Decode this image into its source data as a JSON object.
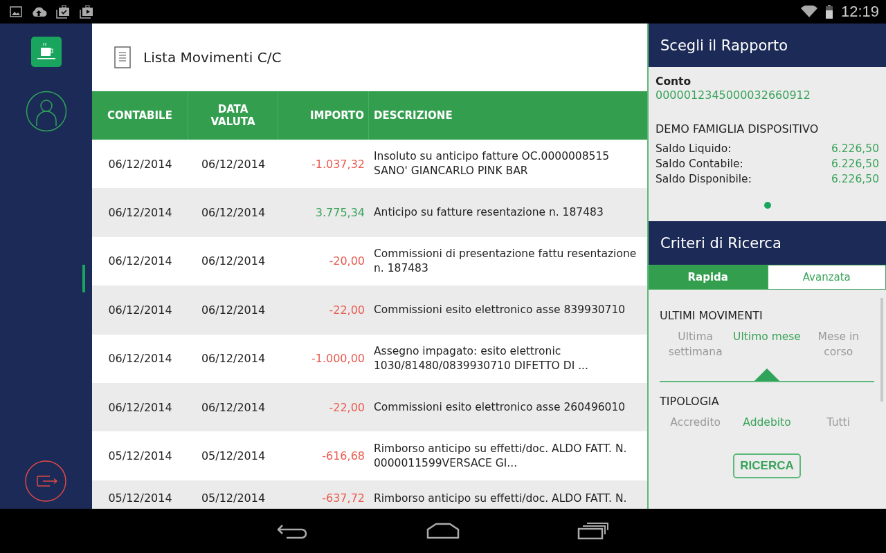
{
  "status_bar": {
    "time": "12:19"
  },
  "page": {
    "title": "Lista Movimenti C/C"
  },
  "table": {
    "columns": [
      "CONTABILE",
      "DATA VALUTA",
      "IMPORTO",
      "DESCRIZIONE"
    ],
    "rows": [
      {
        "contabile": "06/12/2014",
        "valuta": "06/12/2014",
        "importo": "-1.037,32",
        "kind": "debit",
        "descrizione": "Insoluto su anticipo fatture OC.0000008515 SANO' GIANCARLO PINK BAR"
      },
      {
        "contabile": "06/12/2014",
        "valuta": "06/12/2014",
        "importo": "3.775,34",
        "kind": "credit",
        "descrizione": "Anticipo su fatture resentazione n. 187483"
      },
      {
        "contabile": "06/12/2014",
        "valuta": "06/12/2014",
        "importo": "-20,00",
        "kind": "debit",
        "descrizione": "Commissioni di presentazione fattu resentazione n. 187483"
      },
      {
        "contabile": "06/12/2014",
        "valuta": "06/12/2014",
        "importo": "-22,00",
        "kind": "debit",
        "descrizione": "Commissioni esito elettronico asse 839930710"
      },
      {
        "contabile": "06/12/2014",
        "valuta": "06/12/2014",
        "importo": "-1.000,00",
        "kind": "debit",
        "descrizione": "Assegno impagato: esito elettronic 1030/81480/0839930710 DIFETTO DI ..."
      },
      {
        "contabile": "06/12/2014",
        "valuta": "06/12/2014",
        "importo": "-22,00",
        "kind": "debit",
        "descrizione": "Commissioni esito elettronico asse 260496010"
      },
      {
        "contabile": "05/12/2014",
        "valuta": "05/12/2014",
        "importo": "-616,68",
        "kind": "debit",
        "descrizione": "Rimborso anticipo su effetti/doc. ALDO FATT. N. 0000011599VERSACE GI..."
      },
      {
        "contabile": "05/12/2014",
        "valuta": "05/12/2014",
        "importo": "-637,72",
        "kind": "debit",
        "descrizione": "Rimborso anticipo su effetti/doc. ALDO FATT. N."
      }
    ]
  },
  "rapporto": {
    "title": "Scegli il Rapporto",
    "conto_label": "Conto",
    "conto_number": "0000012345000032660912",
    "holder": "DEMO FAMIGLIA DISPOSITIVO",
    "balances": [
      {
        "label": "Saldo Liquido:",
        "value": "6.226,50"
      },
      {
        "label": "Saldo Contabile:",
        "value": "6.226,50"
      },
      {
        "label": "Saldo Disponibile:",
        "value": "6.226,50"
      }
    ]
  },
  "ricerca": {
    "title": "Criteri di Ricerca",
    "tabs": [
      {
        "label": "Rapida",
        "selected": true
      },
      {
        "label": "Avanzata",
        "selected": false
      }
    ],
    "period_title": "ULTIMI MOVIMENTI",
    "periods": [
      {
        "label": "Ultima settimana",
        "selected": false
      },
      {
        "label": "Ultimo mese",
        "selected": true
      },
      {
        "label": "Mese in corso",
        "selected": false
      }
    ],
    "type_title": "TIPOLOGIA",
    "types": [
      {
        "label": "Accredito",
        "selected": false
      },
      {
        "label": "Addebito",
        "selected": true
      },
      {
        "label": "Tutti",
        "selected": false
      }
    ],
    "button": "RICERCA"
  }
}
